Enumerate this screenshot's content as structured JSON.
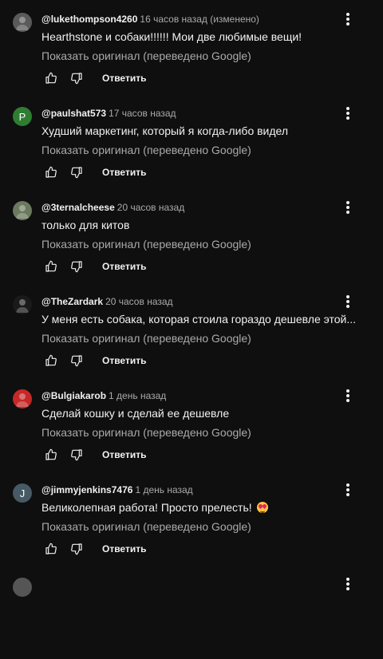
{
  "comments": [
    {
      "author": "@lukethompson4260",
      "time": "16 часов назад (изменено)",
      "text": "Hearthstone и собаки!!!!!! Мои две любимые вещи!",
      "show_original": "Показать оригинал (переведено Google)",
      "reply_label": "Ответить",
      "avatar": {
        "type": "image",
        "icon": "user-photo",
        "color": "#5a5a5a"
      }
    },
    {
      "author": "@paulshat573",
      "time": "17 часов назад",
      "text": "Худший маркетинг, который я когда-либо видел",
      "show_original": "Показать оригинал (переведено Google)",
      "reply_label": "Ответить",
      "avatar": {
        "type": "letter",
        "letter": "P",
        "color": "#2e7d32"
      }
    },
    {
      "author": "@3ternalcheese",
      "time": "20 часов назад",
      "text": "только для китов",
      "show_original": "Показать оригинал (переведено Google)",
      "reply_label": "Ответить",
      "avatar": {
        "type": "image",
        "icon": "user-photo",
        "color": "#6b7a5e"
      }
    },
    {
      "author": "@TheZardark",
      "time": "20 часов назад",
      "text": "У меня есть собака, которая стоила гораздо дешевле этой...",
      "show_original": "Показать оригинал (переведено Google)",
      "reply_label": "Ответить",
      "avatar": {
        "type": "image",
        "icon": "user-photo",
        "color": "#1a1a1a"
      }
    },
    {
      "author": "@Bulgiakarob",
      "time": "1 день назад",
      "text": "Сделай кошку и сделай ее дешевле",
      "show_original": "Показать оригинал (переведено Google)",
      "reply_label": "Ответить",
      "avatar": {
        "type": "image",
        "icon": "user-photo",
        "color": "#c62828"
      }
    },
    {
      "author": "@jimmyjenkins7476",
      "time": "1 день назад",
      "text": "Великолепная работа! Просто прелесть!",
      "emoji": "heart-eyes-emoji",
      "show_original": "Показать оригинал (переведено Google)",
      "reply_label": "Ответить",
      "avatar": {
        "type": "letter",
        "letter": "J",
        "color": "#455a64"
      }
    }
  ]
}
